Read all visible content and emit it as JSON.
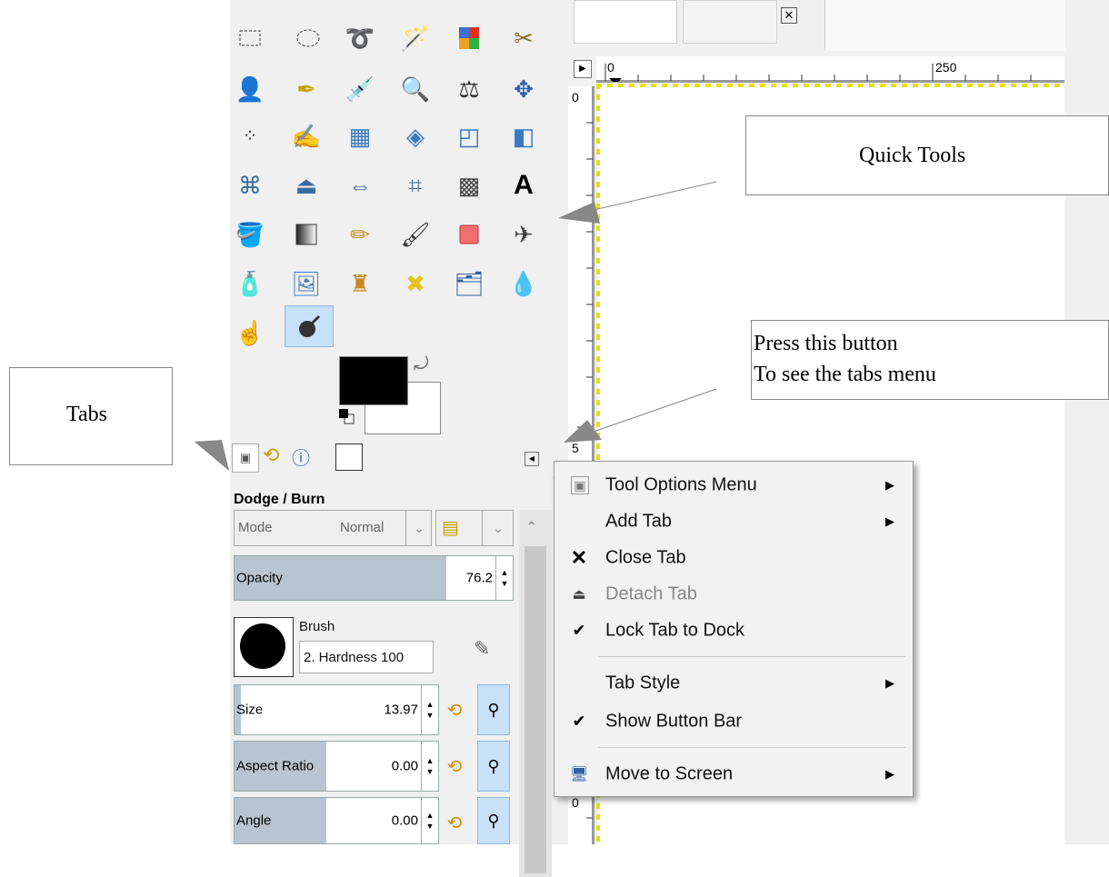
{
  "callouts": {
    "quick_tools": "Quick Tools",
    "tabs": "Tabs",
    "press_line1": "Press this button",
    "press_line2": "To see the tabs menu"
  },
  "ruler": {
    "h_mark_0": "0",
    "h_mark_250": "250",
    "v_mark_0": "0",
    "v_mark_5": "5",
    "v_mark_0b": "0"
  },
  "options": {
    "title": "Dodge / Burn",
    "mode_label": "Mode",
    "mode_value": "Normal",
    "opacity": {
      "label": "Opacity",
      "value": "76.2",
      "fill": 0.762
    },
    "brush_label": "Brush",
    "brush_value": "2. Hardness 100",
    "size": {
      "label": "Size",
      "value": "13.97"
    },
    "aspect": {
      "label": "Aspect Ratio",
      "value": "0.00"
    },
    "angle": {
      "label": "Angle",
      "value": "0.00"
    }
  },
  "menu": {
    "items": [
      {
        "label": "Tool Options Menu",
        "submenu": true
      },
      {
        "label": "Add Tab",
        "submenu": true
      },
      {
        "label": "Close Tab",
        "submenu": false
      },
      {
        "label": "Detach Tab",
        "submenu": false,
        "disabled": true
      },
      {
        "label": "Lock Tab to Dock",
        "submenu": false,
        "checked": true
      },
      {
        "label": "Tab Style",
        "submenu": true
      },
      {
        "label": "Show Button Bar",
        "submenu": false,
        "checked": true
      },
      {
        "label": "Move to Screen",
        "submenu": true
      }
    ]
  },
  "colors": {
    "accent": "#c8e0f8",
    "selection": "#e8e000",
    "slider_fill": "#b8c4cf"
  }
}
